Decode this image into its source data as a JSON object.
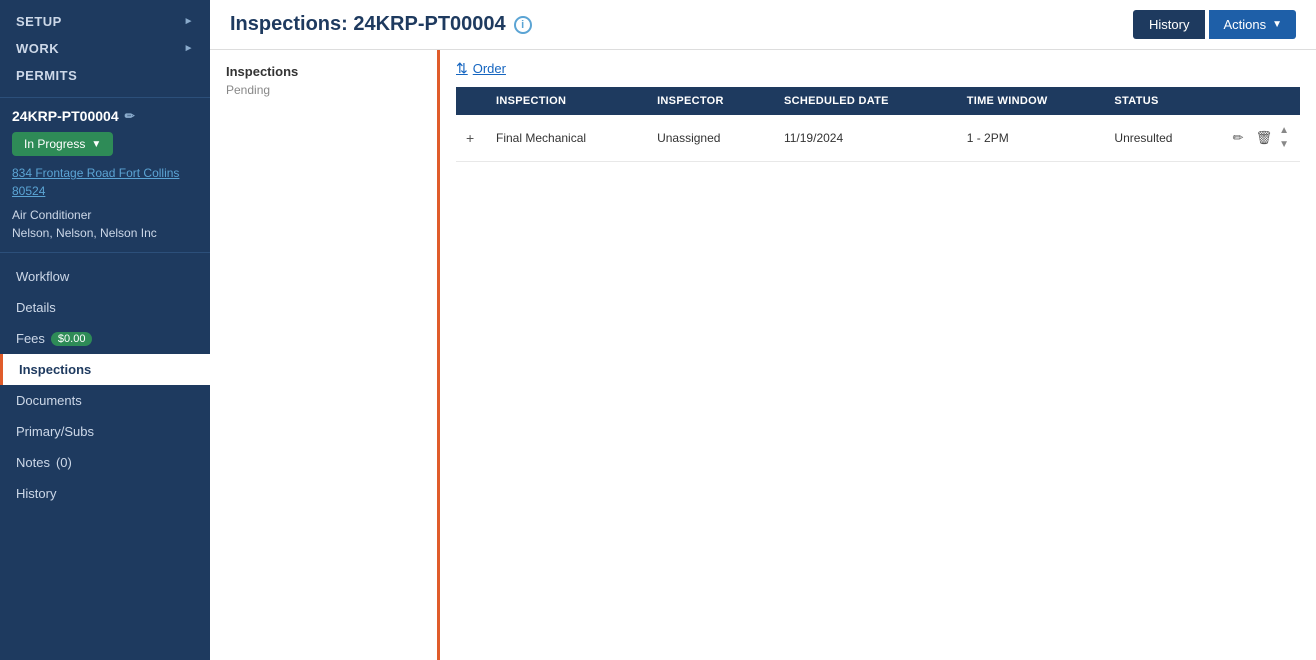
{
  "sidebar": {
    "top_nav": [
      {
        "label": "SETUP",
        "has_arrow": true
      },
      {
        "label": "WORK",
        "has_arrow": true
      },
      {
        "label": "PERMITS",
        "has_arrow": false
      }
    ],
    "permit_id": "24KRP-PT00004",
    "permit_edit_icon": "✏",
    "status_label": "In Progress",
    "status_arrow": "▼",
    "address_line1": "834 Frontage Road Fort Collins",
    "address_line2": "80524",
    "description_line1": "Air Conditioner",
    "description_line2": "Nelson, Nelson, Nelson Inc",
    "nav_items": [
      {
        "label": "Workflow",
        "active": false,
        "id": "workflow"
      },
      {
        "label": "Details",
        "active": false,
        "id": "details"
      },
      {
        "label": "Fees",
        "active": false,
        "id": "fees",
        "badge": "$0.00"
      },
      {
        "label": "Inspections",
        "active": true,
        "id": "inspections"
      },
      {
        "label": "Documents",
        "active": false,
        "id": "documents"
      },
      {
        "label": "Primary/Subs",
        "active": false,
        "id": "primary-subs"
      },
      {
        "label": "Notes",
        "active": false,
        "id": "notes",
        "count": "(0)"
      },
      {
        "label": "History",
        "active": false,
        "id": "history"
      }
    ]
  },
  "header": {
    "title": "Inspections: 24KRP-PT00004",
    "info_icon": "i",
    "history_btn": "History",
    "actions_btn": "Actions",
    "actions_caret": "▼"
  },
  "left_panel": {
    "section_title": "Inspections",
    "section_sub": "Pending"
  },
  "right_panel": {
    "order_label": "Order",
    "order_sort_icon": "⇅",
    "table": {
      "columns": [
        "",
        "INSPECTION",
        "INSPECTOR",
        "SCHEDULED DATE",
        "TIME WINDOW",
        "STATUS",
        ""
      ],
      "rows": [
        {
          "expand_icon": "+",
          "inspection": "Final Mechanical",
          "inspector": "Unassigned",
          "scheduled_date": "11/19/2024",
          "time_window": "1 - 2PM",
          "status": "Unresulted"
        }
      ]
    }
  }
}
